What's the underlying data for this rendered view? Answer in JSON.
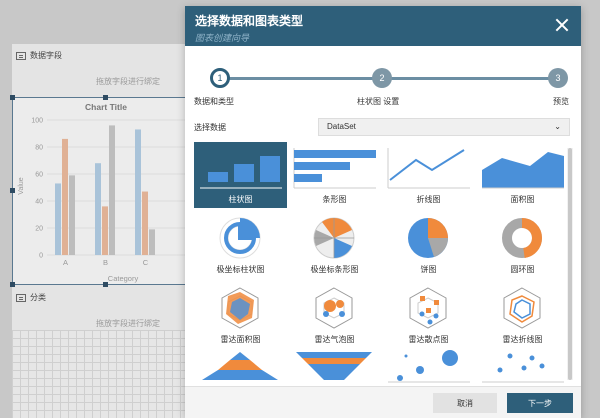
{
  "background": {
    "field_panel_title": "数据字段",
    "drop_hint_1": "拖放字段进行绑定",
    "category_title": "分类",
    "drop_hint_2": "拖放字段进行绑定"
  },
  "chart_data": {
    "type": "bar",
    "title": "Chart Title",
    "xlabel": "Category",
    "ylabel": "Value",
    "ylim": [
      0,
      100
    ],
    "yticks": [
      "0",
      "20",
      "40",
      "60",
      "80",
      "100"
    ],
    "categories": [
      "A",
      "B",
      "C"
    ],
    "series": [
      {
        "values": [
          53,
          68,
          93
        ],
        "color": "#a9c3d9"
      },
      {
        "values": [
          86,
          36,
          47
        ],
        "color": "#e0b195"
      },
      {
        "values": [
          59,
          96,
          19
        ],
        "color": "#bdbdbd"
      }
    ]
  },
  "dialog": {
    "title": "选择数据和图表类型",
    "subtitle": "图表创建向导",
    "steps": [
      {
        "num": "1",
        "label": "数据和类型"
      },
      {
        "num": "2",
        "label": "柱状图 设置"
      },
      {
        "num": "3",
        "label": "预览"
      }
    ],
    "data_source_label": "选择数据",
    "data_source_value": "DataSet",
    "chart_types": [
      {
        "label": "柱状图",
        "icon": "column-chart-icon"
      },
      {
        "label": "条形图",
        "icon": "bar-chart-icon"
      },
      {
        "label": "折线图",
        "icon": "line-chart-icon"
      },
      {
        "label": "面积图",
        "icon": "area-chart-icon"
      },
      {
        "label": "极坐标柱状图",
        "icon": "polar-column-chart-icon"
      },
      {
        "label": "极坐标条形图",
        "icon": "polar-bar-chart-icon"
      },
      {
        "label": "饼图",
        "icon": "pie-chart-icon"
      },
      {
        "label": "圆环图",
        "icon": "donut-chart-icon"
      },
      {
        "label": "雷达面积图",
        "icon": "radar-area-chart-icon"
      },
      {
        "label": "雷达气泡图",
        "icon": "radar-bubble-chart-icon"
      },
      {
        "label": "雷达散点图",
        "icon": "radar-scatter-chart-icon"
      },
      {
        "label": "雷达折线图",
        "icon": "radar-line-chart-icon"
      },
      {
        "label": "",
        "icon": "pyramid-chart-icon"
      },
      {
        "label": "",
        "icon": "funnel-chart-icon"
      },
      {
        "label": "",
        "icon": "bubble-chart-icon"
      },
      {
        "label": "",
        "icon": "scatter-chart-icon"
      }
    ],
    "cancel_label": "取消",
    "next_label": "下一步"
  },
  "colors": {
    "primary": "#2e5f7a",
    "chart_blue": "#4a90d9",
    "chart_orange": "#f08a3c",
    "chart_gray": "#a8a8a8"
  }
}
